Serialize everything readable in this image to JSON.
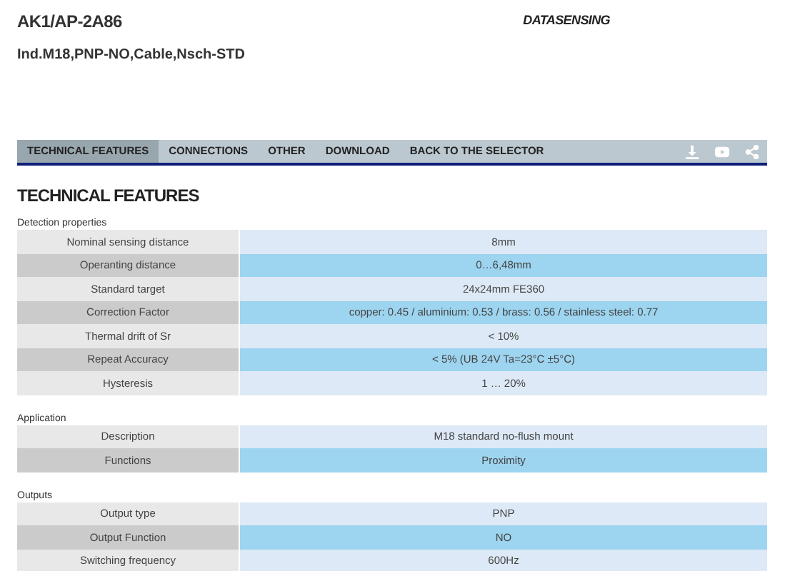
{
  "header": {
    "code": "AK1/AP-2A86",
    "description": "Ind.M18,PNP-NO,Cable,Nsch-STD",
    "logo": "DATASENSING"
  },
  "tabs": [
    {
      "label": "TECHNICAL FEATURES",
      "selected": true
    },
    {
      "label": "CONNECTIONS",
      "selected": false
    },
    {
      "label": "OTHER",
      "selected": false
    },
    {
      "label": "DOWNLOAD",
      "selected": false
    },
    {
      "label": "BACK TO THE SELECTOR",
      "selected": false
    }
  ],
  "toolbar_icons": [
    {
      "kind": "download"
    },
    {
      "kind": "video"
    },
    {
      "kind": "share"
    }
  ],
  "heading": "TECHNICAL FEATURES",
  "sections": [
    {
      "title": "Detection properties",
      "rows": [
        {
          "label": "Nominal sensing distance",
          "value": "8mm"
        },
        {
          "label": "Operanting distance",
          "value": "0…6,48mm"
        },
        {
          "label": "Standard target",
          "value": "24x24mm FE360"
        },
        {
          "label": "Correction Factor",
          "value": "copper: 0.45 / aluminium: 0.53 / brass: 0.56 / stainless steel: 0.77"
        },
        {
          "label": "Thermal drift of Sr",
          "value": "< 10%"
        },
        {
          "label": "Repeat Accuracy",
          "value": "< 5% (UB 24V Ta=23°C ±5°C)"
        },
        {
          "label": "Hysteresis",
          "value": "1 … 20%"
        }
      ]
    },
    {
      "title": "Application",
      "rows": [
        {
          "label": "Description",
          "value": "M18 standard no-flush mount"
        },
        {
          "label": "Functions",
          "value": "Proximity"
        }
      ]
    },
    {
      "title": "Outputs",
      "rows": [
        {
          "label": "Output type",
          "value": "PNP"
        },
        {
          "label": "Output Function",
          "value": "NO"
        },
        {
          "label": "Switching frequency",
          "value": "600Hz"
        }
      ]
    }
  ]
}
